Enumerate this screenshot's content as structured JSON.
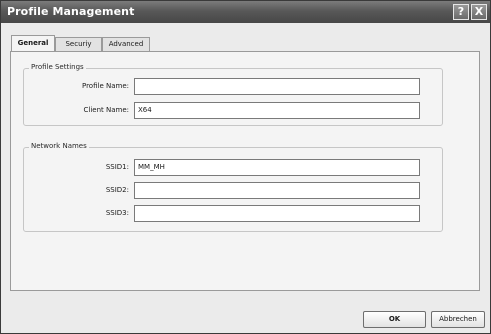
{
  "window": {
    "title": "Profile Management",
    "help_button": "?",
    "close_button": "X"
  },
  "tabs": [
    {
      "label": "General",
      "active": true
    },
    {
      "label": "Securiy",
      "active": false
    },
    {
      "label": "Advanced",
      "active": false
    }
  ],
  "profile_settings": {
    "title": "Profile Settings",
    "profile_name": {
      "label": "Profile Name:",
      "value": ""
    },
    "client_name": {
      "label": "Client Name:",
      "value": "X64"
    }
  },
  "network_names": {
    "title": "Network Names",
    "ssids": [
      {
        "label": "SSID1:",
        "value": "MM_MH"
      },
      {
        "label": "SSID2:",
        "value": ""
      },
      {
        "label": "SSID3:",
        "value": ""
      }
    ]
  },
  "buttons": {
    "ok": "OK",
    "cancel": "Abbrechen"
  },
  "colors": {
    "titlebar": "#585858",
    "dialog_bg": "#ebebeb",
    "panel_bg": "#f4f4f4"
  }
}
